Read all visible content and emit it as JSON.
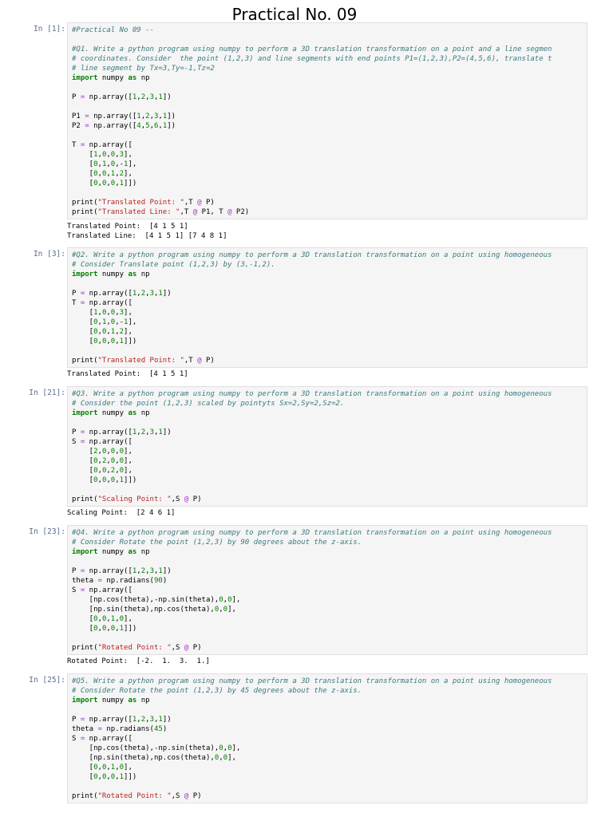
{
  "page": {
    "title": "Practical No. 09"
  },
  "cells": [
    {
      "prompt": "In [1]:",
      "lines": [
        "#Practical No 09 --",
        "",
        "#Q1. Write a python program using numpy to perform a 3D translation transformation on a point and a line segmen",
        "# coordinates. Consider  the point (1,2,3) and line segments with end points P1=(1,2,3),P2=(4,5,6), translate t",
        "# line segment by Tx=3,Ty=-1,Tz=2",
        "import numpy as np",
        "",
        "P = np.array([1,2,3,1])",
        "",
        "P1 = np.array([1,2,3,1])",
        "P2 = np.array([4,5,6,1])",
        "",
        "T = np.array([",
        "    [1,0,0,3],",
        "    [0,1,0,-1],",
        "    [0,0,1,2],",
        "    [0,0,0,1]])",
        "",
        "print(\"Translated Point: \",T @ P)",
        "print(\"Translated Line: \",T @ P1, T @ P2)"
      ],
      "output": [
        "Translated Point:  [4 1 5 1]",
        "Translated Line:  [4 1 5 1] [7 4 8 1]"
      ]
    },
    {
      "prompt": "In [3]:",
      "lines": [
        "#Q2. Write a python program using numpy to perform a 3D translation transformation on a point using homogeneous",
        "# Consider Translate point (1,2,3) by (3,-1,2).",
        "import numpy as np",
        "",
        "P = np.array([1,2,3,1])",
        "T = np.array([",
        "    [1,0,0,3],",
        "    [0,1,0,-1],",
        "    [0,0,1,2],",
        "    [0,0,0,1]])",
        "",
        "print(\"Translated Point: \",T @ P)"
      ],
      "output": [
        "Translated Point:  [4 1 5 1]"
      ]
    },
    {
      "prompt": "In [21]:",
      "lines": [
        "#Q3. Write a python program using numpy to perform a 3D translation transformation on a point using homogeneous",
        "# Consider the point (1,2,3) scaled by pointyts Sx=2,Sy=2,Sz=2.",
        "import numpy as np",
        "",
        "P = np.array([1,2,3,1])",
        "S = np.array([",
        "    [2,0,0,0],",
        "    [0,2,0,0],",
        "    [0,0,2,0],",
        "    [0,0,0,1]])",
        "",
        "print(\"Scaling Point: \",S @ P)"
      ],
      "output": [
        "Scaling Point:  [2 4 6 1]"
      ]
    },
    {
      "prompt": "In [23]:",
      "lines": [
        "#Q4. Write a python program using numpy to perform a 3D translation transformation on a point using homogeneous",
        "# Consider Rotate the point (1,2,3) by 90 degrees about the z-axis.",
        "import numpy as np",
        "",
        "P = np.array([1,2,3,1])",
        "theta = np.radians(90)",
        "S = np.array([",
        "    [np.cos(theta),-np.sin(theta),0,0],",
        "    [np.sin(theta),np.cos(theta),0,0],",
        "    [0,0,1,0],",
        "    [0,0,0,1]])",
        "",
        "print(\"Rotated Point: \",S @ P)"
      ],
      "output": [
        "Rotated Point:  [-2.  1.  3.  1.]"
      ]
    },
    {
      "prompt": "In [25]:",
      "lines": [
        "#Q5. Write a python program using numpy to perform a 3D translation transformation on a point using homogeneous",
        "# Consider Rotate the point (1,2,3) by 45 degrees about the z-axis.",
        "import numpy as np",
        "",
        "P = np.array([1,2,3,1])",
        "theta = np.radians(45)",
        "S = np.array([",
        "    [np.cos(theta),-np.sin(theta),0,0],",
        "    [np.sin(theta),np.cos(theta),0,0],",
        "    [0,0,1,0],",
        "    [0,0,0,1]])",
        "",
        "print(\"Rotated Point: \",S @ P)"
      ],
      "output": []
    }
  ]
}
